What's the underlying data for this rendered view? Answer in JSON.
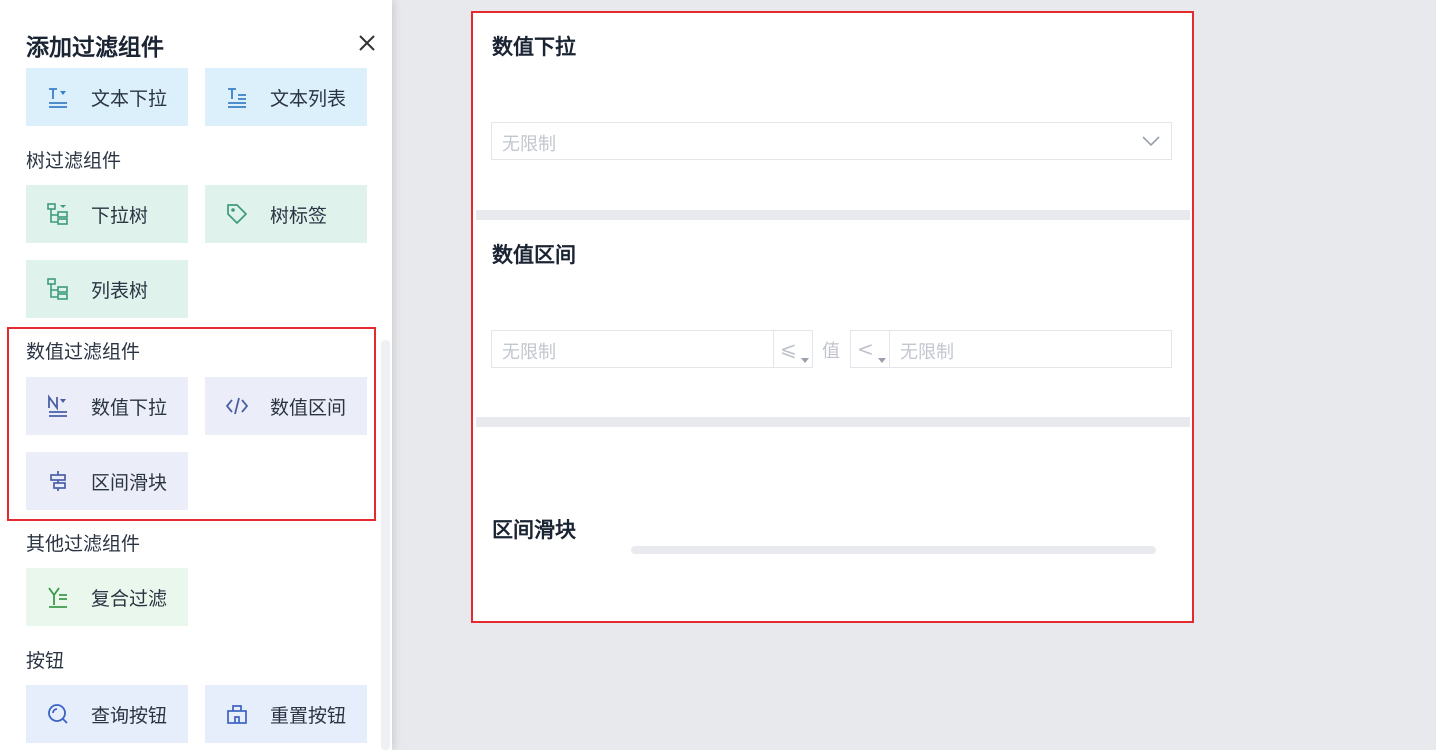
{
  "panel": {
    "title": "添加过滤组件",
    "sections": {
      "tree": "树过滤组件",
      "number": "数值过滤组件",
      "other": "其他过滤组件",
      "button": "按钮"
    },
    "items": {
      "text_dropdown": "文本下拉",
      "text_list": "文本列表",
      "tree_dropdown": "下拉树",
      "tree_tag": "树标签",
      "tree_list": "列表树",
      "num_dropdown": "数值下拉",
      "num_range": "数值区间",
      "range_slider": "区间滑块",
      "composite_filter": "复合过滤",
      "query_button": "查询按钮",
      "reset_button": "重置按钮"
    }
  },
  "canvas": {
    "num_dropdown": {
      "title": "数值下拉",
      "placeholder": "无限制"
    },
    "num_range": {
      "title": "数值区间",
      "min_placeholder": "无限制",
      "op_left": "⩽",
      "value_label": "值",
      "op_right": "<",
      "max_placeholder": "无限制"
    },
    "range_slider": {
      "title": "区间滑块"
    }
  },
  "colors": {
    "highlight": "#e22a2f",
    "text_item_bg": "#dcf0fb",
    "tree_item_bg": "#dff2ec",
    "num_item_bg": "#ebeef8",
    "other_item_bg": "#eaf7ec",
    "button_item_bg": "#e6edfb"
  }
}
